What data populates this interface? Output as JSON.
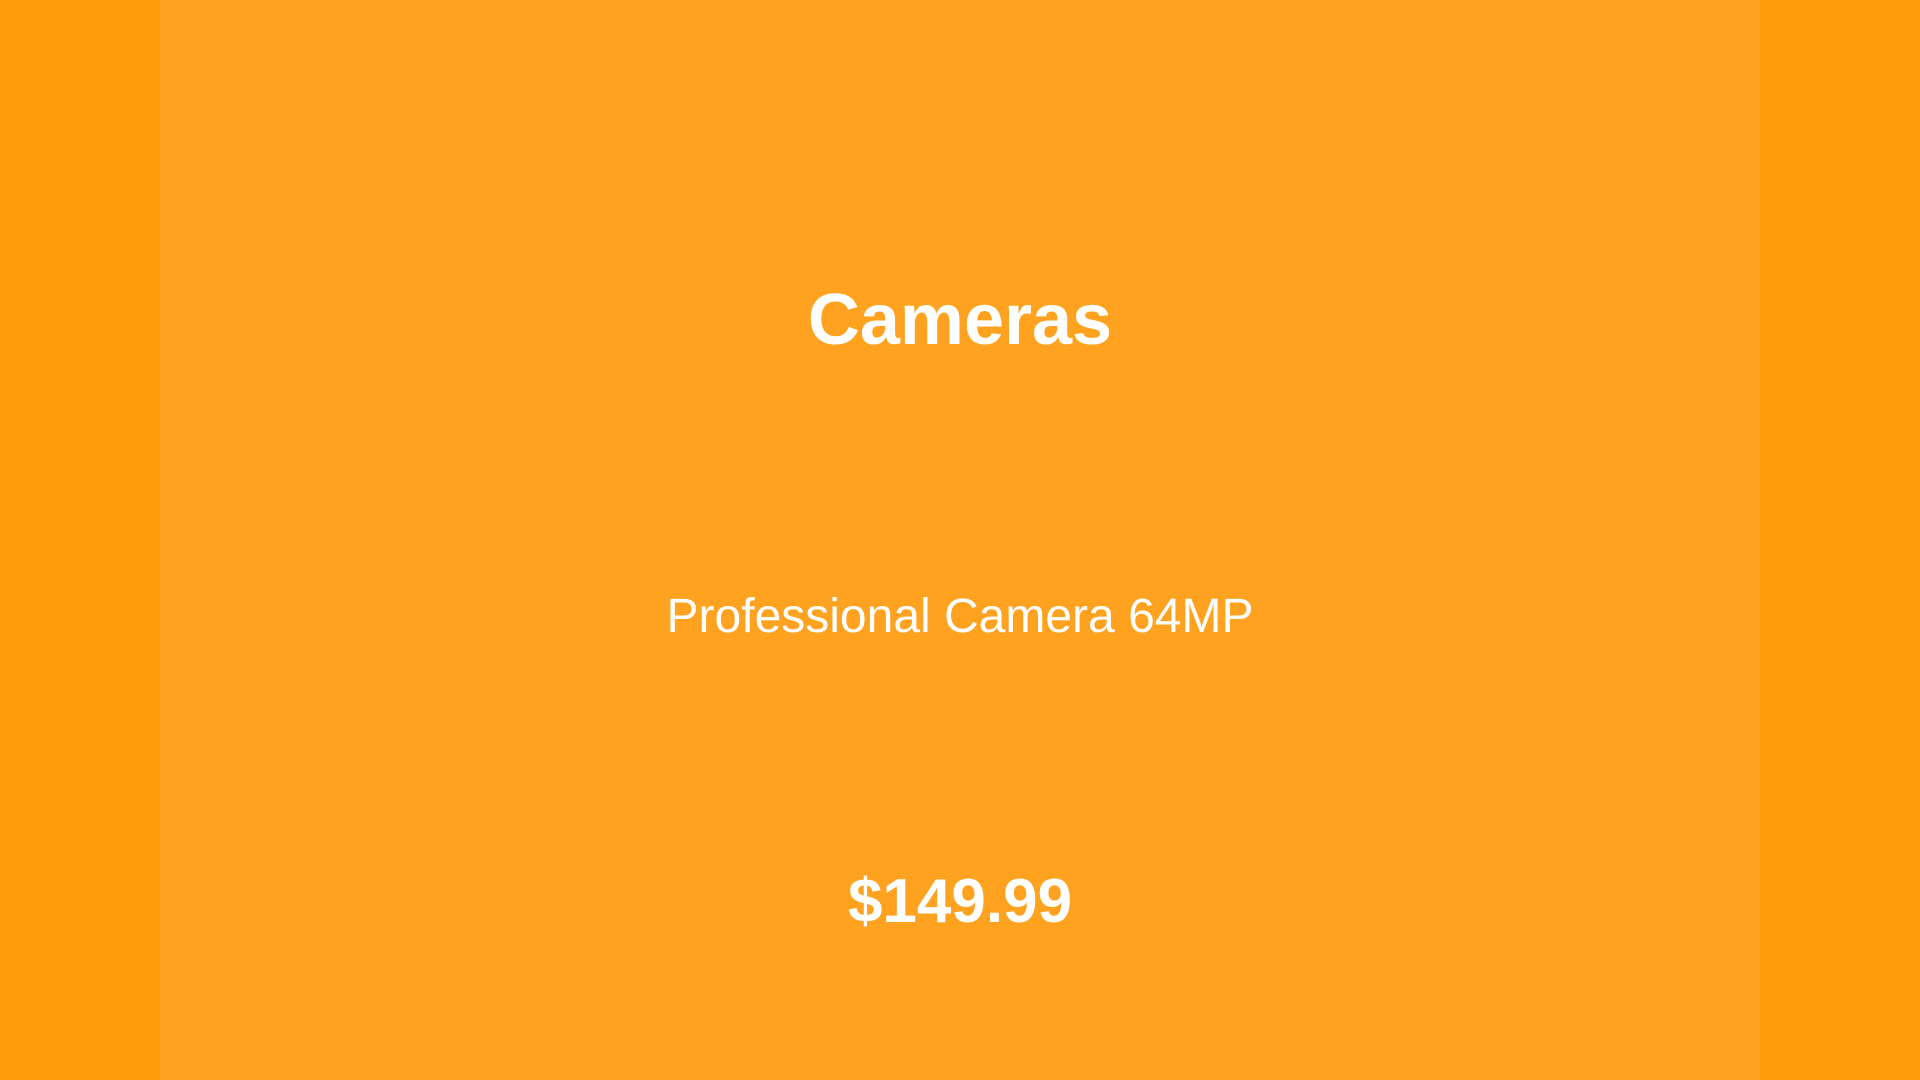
{
  "product_card": {
    "category": "Cameras",
    "name": "Professional Camera 64MP",
    "price": "$149.99"
  },
  "colors": {
    "background": "#ff9a0a",
    "card": "#ffa21f",
    "text": "#ffffff"
  }
}
